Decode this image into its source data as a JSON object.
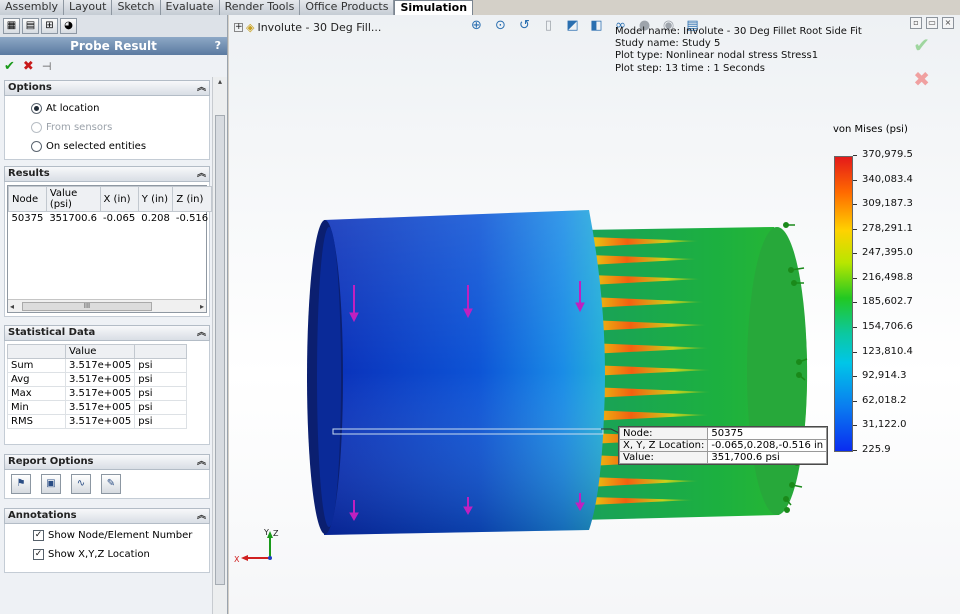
{
  "tabs": [
    "Assembly",
    "Layout",
    "Sketch",
    "Evaluate",
    "Render Tools",
    "Office Products",
    "Simulation"
  ],
  "active_tab": "Simulation",
  "panel": {
    "title": "Probe Result",
    "help": "?",
    "options": {
      "header": "Options",
      "at_location": "At location",
      "from_sensors": "From sensors",
      "on_selected": "On selected entities"
    },
    "results": {
      "header": "Results",
      "columns": [
        "Node",
        "Value (psi)",
        "X (in)",
        "Y (in)",
        "Z (in)"
      ],
      "rows": [
        [
          "50375",
          "351700.6",
          "-0.065",
          "0.208",
          "-0.516"
        ]
      ]
    },
    "statistical": {
      "header": "Statistical Data",
      "column": "Value",
      "rows": [
        {
          "label": "Sum",
          "value": "3.517e+005",
          "unit": "psi"
        },
        {
          "label": "Avg",
          "value": "3.517e+005",
          "unit": "psi"
        },
        {
          "label": "Max",
          "value": "3.517e+005",
          "unit": "psi"
        },
        {
          "label": "Min",
          "value": "3.517e+005",
          "unit": "psi"
        },
        {
          "label": "RMS",
          "value": "3.517e+005",
          "unit": "psi"
        }
      ]
    },
    "report_header": "Report Options",
    "annotations": {
      "header": "Annotations",
      "show_node": "Show Node/Element Number",
      "show_xyz": "Show X,Y,Z Location"
    }
  },
  "viewport": {
    "tree_root": "Involute - 30 Deg Fill...",
    "study_info": [
      "Model name: Involute - 30 Deg Fillet Root Side Fit",
      "Study name: Study 5",
      "Plot type: Nonlinear nodal stress Stress1",
      "Plot step: 13   time : 1 Seconds"
    ],
    "legend": {
      "title": "von Mises (psi)",
      "ticks": [
        "370,979.5",
        "340,083.4",
        "309,187.3",
        "278,291.1",
        "247,395.0",
        "216,498.8",
        "185,602.7",
        "154,706.6",
        "123,810.4",
        "92,914.3",
        "62,018.2",
        "31,122.0",
        "225.9"
      ]
    },
    "probe": {
      "node_label": "Node:",
      "node_value": "50375",
      "loc_label": "X, Y, Z Location:",
      "loc_value": "-0.065,0.208,-0.516 in",
      "value_label": "Value:",
      "value_value": "351,700.6 psi"
    },
    "triad": {
      "x": "X",
      "y": "Y",
      "z": "Z"
    }
  },
  "colors": {
    "panel_title_bg": "#5b7aa0",
    "ok": "#1a9a1a",
    "cancel": "#c81a1a"
  }
}
